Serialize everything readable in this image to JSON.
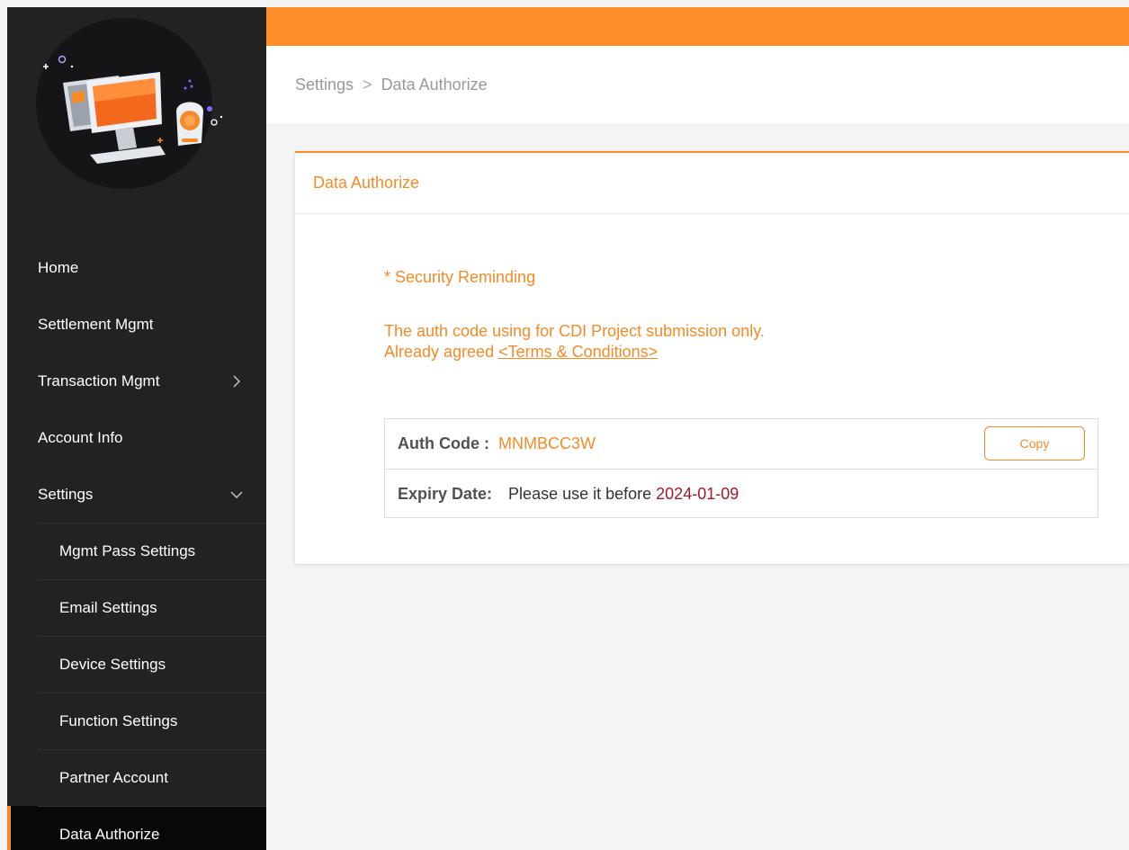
{
  "sidebar": {
    "items": [
      {
        "label": "Home"
      },
      {
        "label": "Settlement Mgmt"
      },
      {
        "label": "Transaction Mgmt",
        "chevron": "chevron-right-icon"
      },
      {
        "label": "Account Info"
      },
      {
        "label": "Settings",
        "chevron": "chevron-down-icon"
      }
    ],
    "sub_items": [
      {
        "label": "Mgmt Pass Settings"
      },
      {
        "label": "Email Settings"
      },
      {
        "label": "Device Settings"
      },
      {
        "label": "Function Settings"
      },
      {
        "label": "Partner Account"
      },
      {
        "label": "Data Authorize",
        "active": true
      }
    ]
  },
  "breadcrumb": {
    "parent": "Settings",
    "separator": ">",
    "current": "Data Authorize"
  },
  "card": {
    "title": "Data Authorize",
    "reminder": "* Security Reminding",
    "notice_line1": "The auth code using for CDI Project submission only.",
    "notice_line2_prefix": "Already agreed ",
    "terms_link": "<Terms & Conditions>",
    "auth_code_label": "Auth Code :",
    "auth_code_value": "MNMBCC3W",
    "copy_label": "Copy",
    "expiry_label": "Expiry Date:",
    "expiry_text": "Please use it before",
    "expiry_date": "2024-01-09"
  },
  "colors": {
    "accent": "#f58a26",
    "topbar": "#ff8e2b",
    "sidebar_bg": "#222222",
    "expiry_date": "#a11a2e"
  }
}
